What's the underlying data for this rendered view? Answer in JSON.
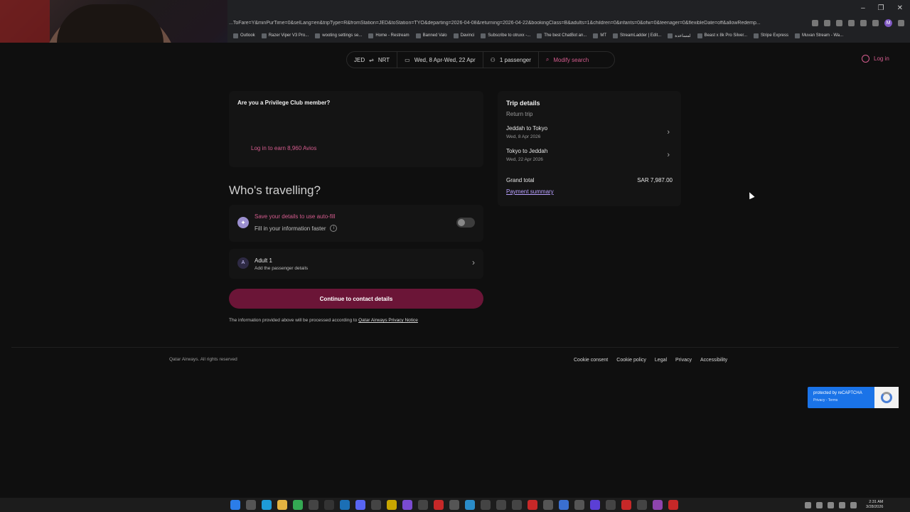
{
  "browser": {
    "url": "...ToFare=Y&minPurTime=0&selLang=en&tripType=R&fromStation=JED&toStation=TYO&departing=2026-04-08&returning=2026-04-22&bookingClass=B&adults=1&children=0&infants=0&ofw=0&teenager=0&flexibleDate=off&allowRedemp...",
    "bookmarks": [
      "Outlook",
      "Razer Viper V3 Pro...",
      "wooting settings se...",
      "Home - Restream",
      "Banned Valo",
      "Davinci",
      "Subscribe to otruxx -...",
      "The best ChatBot an...",
      "MT",
      "StreamLadder | Edit...",
      "لمساعدة",
      "Beast x 8k Pro Silver...",
      "Stripe Express",
      "Muvan Stream - Wa..."
    ],
    "profile_initial": "M"
  },
  "search": {
    "from": "JED",
    "to": "NRT",
    "dates": "Wed, 8 Apr-Wed, 22 Apr",
    "passengers": "1 passenger",
    "modify": "Modify search"
  },
  "header": {
    "login": "Log in"
  },
  "privilege": {
    "title": "Are you a Privilege Club member?",
    "subtitle": "",
    "login_link": "Log in to earn 8,960 Avios"
  },
  "trip": {
    "title": "Trip details",
    "type": "Return trip",
    "legs": [
      {
        "route": "Jeddah to Tokyo",
        "date": "Wed, 8 Apr 2026"
      },
      {
        "route": "Tokyo to Jeddah",
        "date": "Wed, 22 Apr 2026"
      }
    ],
    "total_label": "Grand total",
    "total_value": "SAR 7,987.00",
    "payment_link": "Payment summary"
  },
  "travellers": {
    "heading": "Who's travelling?",
    "autofill_title": "Save your details to use auto-fill",
    "autofill_sub": "Fill in your information faster",
    "adult_badge": "A",
    "adult_title": "Adult 1",
    "adult_sub": "Add the passenger details",
    "continue": "Continue to contact details",
    "notice": "The information provided above will be processed according to ",
    "notice_link": "Qatar Airways Privacy Notice"
  },
  "footer": {
    "copyright": "Qatar Airways. All rights reserved",
    "links": [
      "Cookie consent",
      "Cookie policy",
      "Legal",
      "Privacy",
      "Accessibility"
    ]
  },
  "recaptcha": {
    "line1": "protected by reCAPTCHA",
    "line2": "Privacy - Terms"
  },
  "taskbar": {
    "time": "2:31 AM",
    "date": "3/28/2026"
  },
  "colors": {
    "accent": "#d45c8e",
    "cta": "#6b1537",
    "background": "#0f0f0f"
  }
}
